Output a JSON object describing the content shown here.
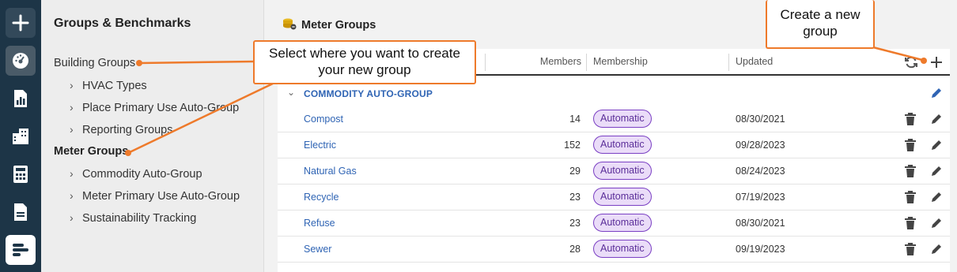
{
  "sidebar": {
    "title": "Groups & Benchmarks",
    "items": [
      {
        "label": "Building Groups",
        "level": 0
      },
      {
        "label": "HVAC Types",
        "level": 1
      },
      {
        "label": "Place Primary Use Auto-Group",
        "level": 1
      },
      {
        "label": "Reporting Groups",
        "level": 1
      },
      {
        "label": "Meter Groups",
        "level": 0
      },
      {
        "label": "Commodity Auto-Group",
        "level": 1
      },
      {
        "label": "Meter Primary Use Auto-Group",
        "level": 1
      },
      {
        "label": "Sustainability Tracking",
        "level": 1
      }
    ]
  },
  "main": {
    "title": "Meter Groups",
    "columns": {
      "members": "Members",
      "membership": "Membership",
      "updated": "Updated"
    },
    "group_header": "COMMODITY AUTO-GROUP",
    "rows": [
      {
        "name": "Compost",
        "members": "14",
        "membership": "Automatic",
        "updated": "08/30/2021"
      },
      {
        "name": "Electric",
        "members": "152",
        "membership": "Automatic",
        "updated": "09/28/2023"
      },
      {
        "name": "Natural Gas",
        "members": "29",
        "membership": "Automatic",
        "updated": "08/24/2023"
      },
      {
        "name": "Recycle",
        "members": "23",
        "membership": "Automatic",
        "updated": "07/19/2023"
      },
      {
        "name": "Refuse",
        "members": "23",
        "membership": "Automatic",
        "updated": "08/30/2021"
      },
      {
        "name": "Sewer",
        "members": "28",
        "membership": "Automatic",
        "updated": "09/19/2023"
      }
    ]
  },
  "callouts": {
    "select_location": "Select where you want to create your new group",
    "create_new": "Create a new group"
  },
  "colors": {
    "rail": "#1d3547",
    "accent": "#ee7a2b",
    "link": "#2f64b4",
    "badge_border": "#7a3fc3",
    "badge_fill": "#eadcf8"
  },
  "icons": [
    "plus-icon",
    "dashboard-icon",
    "report-icon",
    "buildings-icon",
    "calculator-icon",
    "document-icon",
    "groups-icon",
    "refresh-icon",
    "add-icon",
    "edit-icon",
    "trash-icon",
    "meter-groups-icon"
  ]
}
